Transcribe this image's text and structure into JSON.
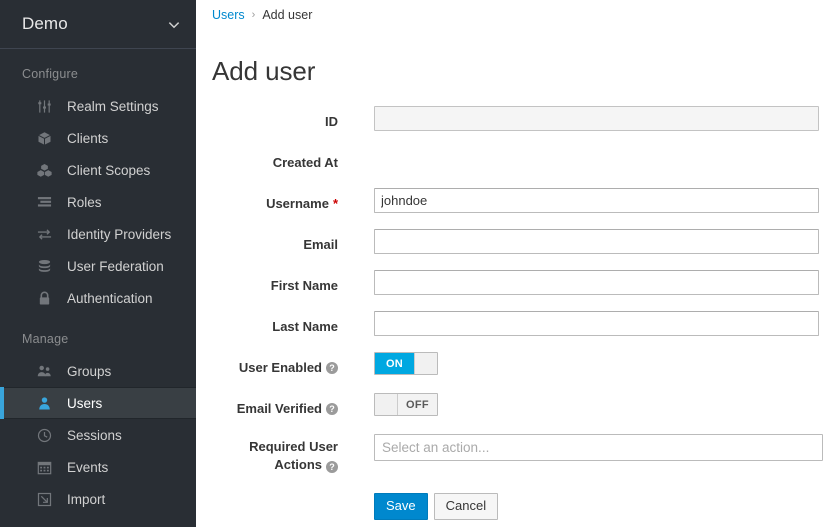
{
  "sidebar": {
    "realm": {
      "name": "Demo",
      "chevron_icon": "chevron-down-icon"
    },
    "sections": [
      {
        "title": "Configure",
        "items": [
          {
            "label": "Realm Settings",
            "icon": "sliders-icon",
            "active": false
          },
          {
            "label": "Clients",
            "icon": "cube-icon",
            "active": false
          },
          {
            "label": "Client Scopes",
            "icon": "cubes-icon",
            "active": false
          },
          {
            "label": "Roles",
            "icon": "list-icon",
            "active": false
          },
          {
            "label": "Identity Providers",
            "icon": "exchange-arrows-icon",
            "active": false
          },
          {
            "label": "User Federation",
            "icon": "database-icon",
            "active": false
          },
          {
            "label": "Authentication",
            "icon": "lock-icon",
            "active": false
          }
        ]
      },
      {
        "title": "Manage",
        "items": [
          {
            "label": "Groups",
            "icon": "users-group-icon",
            "active": false
          },
          {
            "label": "Users",
            "icon": "user-icon",
            "active": true
          },
          {
            "label": "Sessions",
            "icon": "clock-icon",
            "active": false
          },
          {
            "label": "Events",
            "icon": "calendar-icon",
            "active": false
          },
          {
            "label": "Import",
            "icon": "import-arrow-icon",
            "active": false
          }
        ]
      }
    ]
  },
  "breadcrumb": {
    "parent": "Users",
    "separator": "›",
    "current": "Add user"
  },
  "page": {
    "title": "Add user"
  },
  "form": {
    "id": {
      "label": "ID",
      "value": "",
      "placeholder": "",
      "disabled": true
    },
    "created_at": {
      "label": "Created At",
      "value": ""
    },
    "username": {
      "label": "Username",
      "required_marker": "*",
      "value": "johndoe",
      "placeholder": ""
    },
    "email": {
      "label": "Email",
      "value": "",
      "placeholder": ""
    },
    "first_name": {
      "label": "First Name",
      "value": "",
      "placeholder": ""
    },
    "last_name": {
      "label": "Last Name",
      "value": "",
      "placeholder": ""
    },
    "user_enabled": {
      "label": "User Enabled",
      "help_icon": "help-circle-icon",
      "help_glyph": "?",
      "state": "ON",
      "on": true
    },
    "email_verified": {
      "label": "Email Verified",
      "help_icon": "help-circle-icon",
      "help_glyph": "?",
      "state": "OFF",
      "on": false
    },
    "required_user_actions": {
      "label_line1": "Required User",
      "label_line2": "Actions",
      "help_icon": "help-circle-icon",
      "help_glyph": "?",
      "placeholder": "Select an action...",
      "value": ""
    }
  },
  "buttons": {
    "save": "Save",
    "cancel": "Cancel"
  },
  "colors": {
    "sidebar_bg": "#292e34",
    "sidebar_active_bg": "#393f44",
    "accent_blue": "#0088ce",
    "toggle_on_blue": "#00a8e1",
    "required_red": "#cc0000",
    "text_dark": "#363636"
  }
}
